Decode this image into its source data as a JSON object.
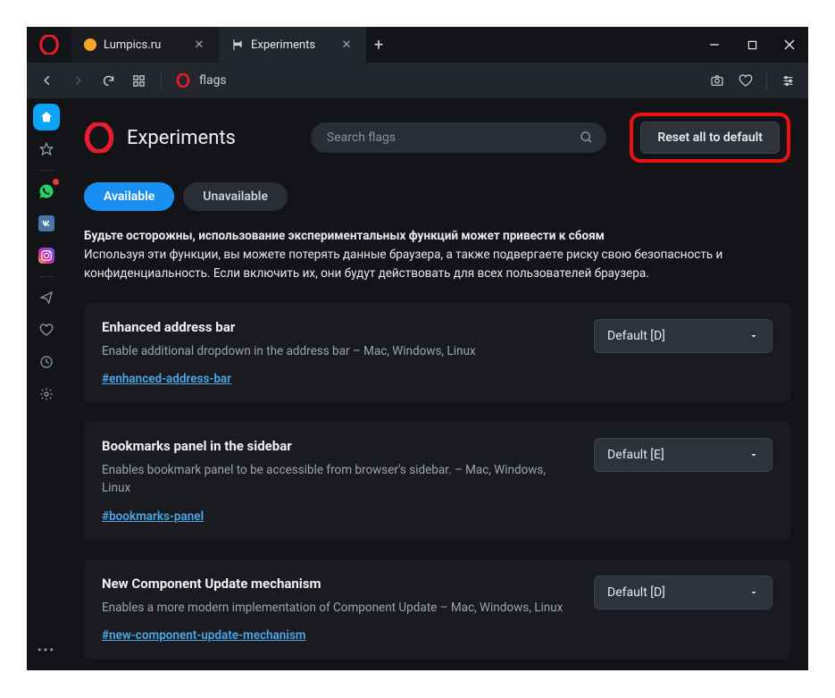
{
  "tabs": [
    {
      "title": "Lumpics.ru",
      "active": false,
      "icon_color": "#f5a623"
    },
    {
      "title": "Experiments",
      "active": true,
      "icon_color": "#cdd1d6"
    }
  ],
  "url": "flags",
  "page_title": "Experiments",
  "search_placeholder": "Search flags",
  "reset_label": "Reset all to default",
  "filter_tabs": {
    "available": "Available",
    "unavailable": "Unavailable"
  },
  "warning": {
    "line1": "Будьте осторожны, использование экспериментальных функций может привести к сбоям",
    "line2": "Используя эти функции, вы можете потерять данные браузера, а также подвергаете риску свою безопасность и конфиденциальность. Если включить их, они будут действовать для всех пользователей браузера."
  },
  "flags": [
    {
      "title": "Enhanced address bar",
      "desc": "Enable additional dropdown in the address bar – Mac, Windows, Linux",
      "link": "#enhanced-address-bar",
      "value": "Default [D]"
    },
    {
      "title": "Bookmarks panel in the sidebar",
      "desc": "Enables bookmark panel to be accessible from browser's sidebar. – Mac, Windows, Linux",
      "link": "#bookmarks-panel",
      "value": "Default [E]"
    },
    {
      "title": "New Component Update mechanism",
      "desc": "Enables a more modern implementation of Component Update – Mac, Windows, Linux",
      "link": "#new-component-update-mechanism",
      "value": "Default [D]"
    }
  ]
}
